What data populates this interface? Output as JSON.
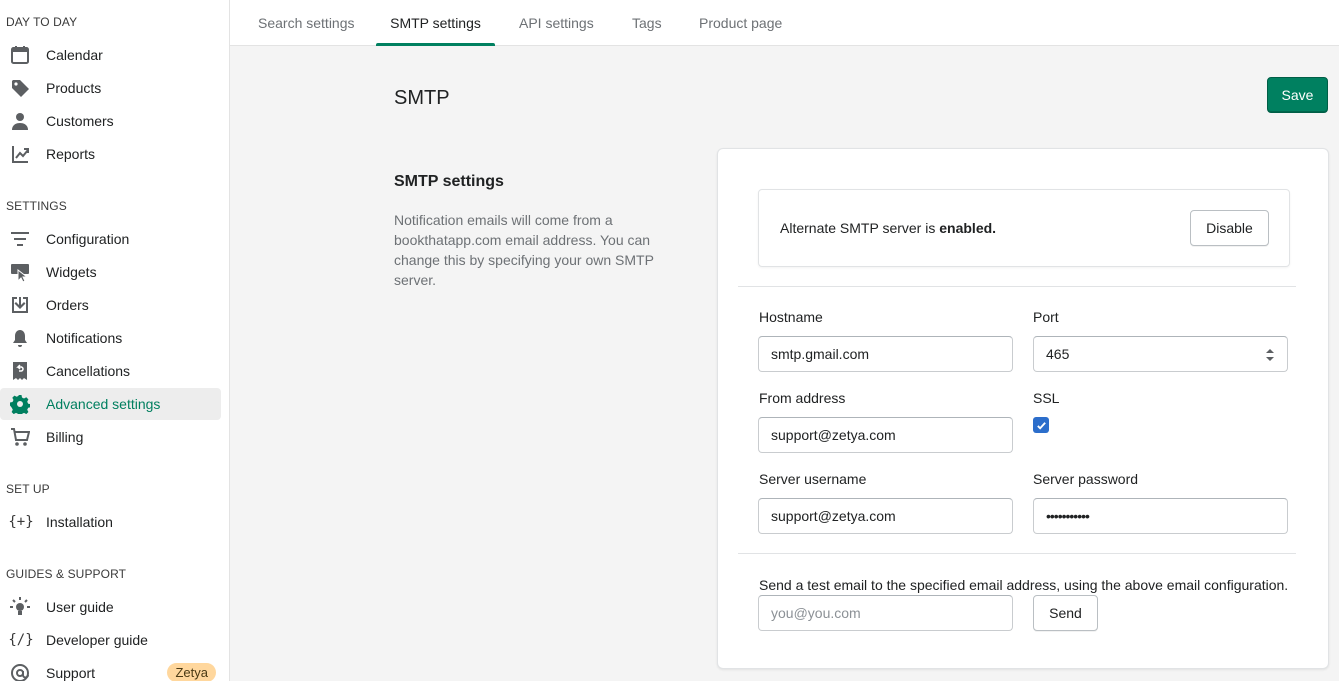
{
  "sidebar": {
    "sections": [
      {
        "title": "DAY TO DAY",
        "items": [
          {
            "label": "Calendar",
            "icon": "calendar-icon"
          },
          {
            "label": "Products",
            "icon": "tag-icon"
          },
          {
            "label": "Customers",
            "icon": "person-icon"
          },
          {
            "label": "Reports",
            "icon": "reports-icon"
          }
        ]
      },
      {
        "title": "SETTINGS",
        "items": [
          {
            "label": "Configuration",
            "icon": "sliders-icon"
          },
          {
            "label": "Widgets",
            "icon": "widgets-icon"
          },
          {
            "label": "Orders",
            "icon": "orders-icon"
          },
          {
            "label": "Notifications",
            "icon": "bell-icon"
          },
          {
            "label": "Cancellations",
            "icon": "receipt-icon"
          },
          {
            "label": "Advanced settings",
            "icon": "gear-icon",
            "active": true
          },
          {
            "label": "Billing",
            "icon": "cart-icon"
          }
        ]
      },
      {
        "title": "SET UP",
        "items": [
          {
            "label": "Installation",
            "icon": "braces-plus-icon"
          }
        ]
      },
      {
        "title": "GUIDES & SUPPORT",
        "items": [
          {
            "label": "User guide",
            "icon": "lightbulb-icon"
          },
          {
            "label": "Developer guide",
            "icon": "code-icon"
          },
          {
            "label": "Support",
            "icon": "at-icon",
            "badge": "Zetya"
          }
        ]
      }
    ]
  },
  "tabs": [
    {
      "label": "Search settings"
    },
    {
      "label": "SMTP settings",
      "active": true
    },
    {
      "label": "API settings"
    },
    {
      "label": "Tags"
    },
    {
      "label": "Product page"
    }
  ],
  "page": {
    "title": "SMTP",
    "save_label": "Save"
  },
  "section": {
    "heading": "SMTP settings",
    "description": "Notification emails will come from a bookthatapp.com email address. You can change this by specifying your own SMTP server."
  },
  "banner": {
    "text_prefix": "Alternate SMTP server is ",
    "status": "enabled.",
    "disable_label": "Disable"
  },
  "form": {
    "hostname_label": "Hostname",
    "hostname_value": "smtp.gmail.com",
    "port_label": "Port",
    "port_value": "465",
    "from_label": "From address",
    "from_value": "support@zetya.com",
    "ssl_label": "SSL",
    "ssl_checked": true,
    "username_label": "Server username",
    "username_value": "support@zetya.com",
    "password_label": "Server password",
    "password_value": "•••••••••••"
  },
  "test": {
    "description": "Send a test email to the specified email address, using the above email configuration.",
    "placeholder": "you@you.com",
    "send_label": "Send"
  },
  "colors": {
    "accent": "#008060",
    "checkbox": "#2c6ecb",
    "badge": "#ffd79d"
  }
}
